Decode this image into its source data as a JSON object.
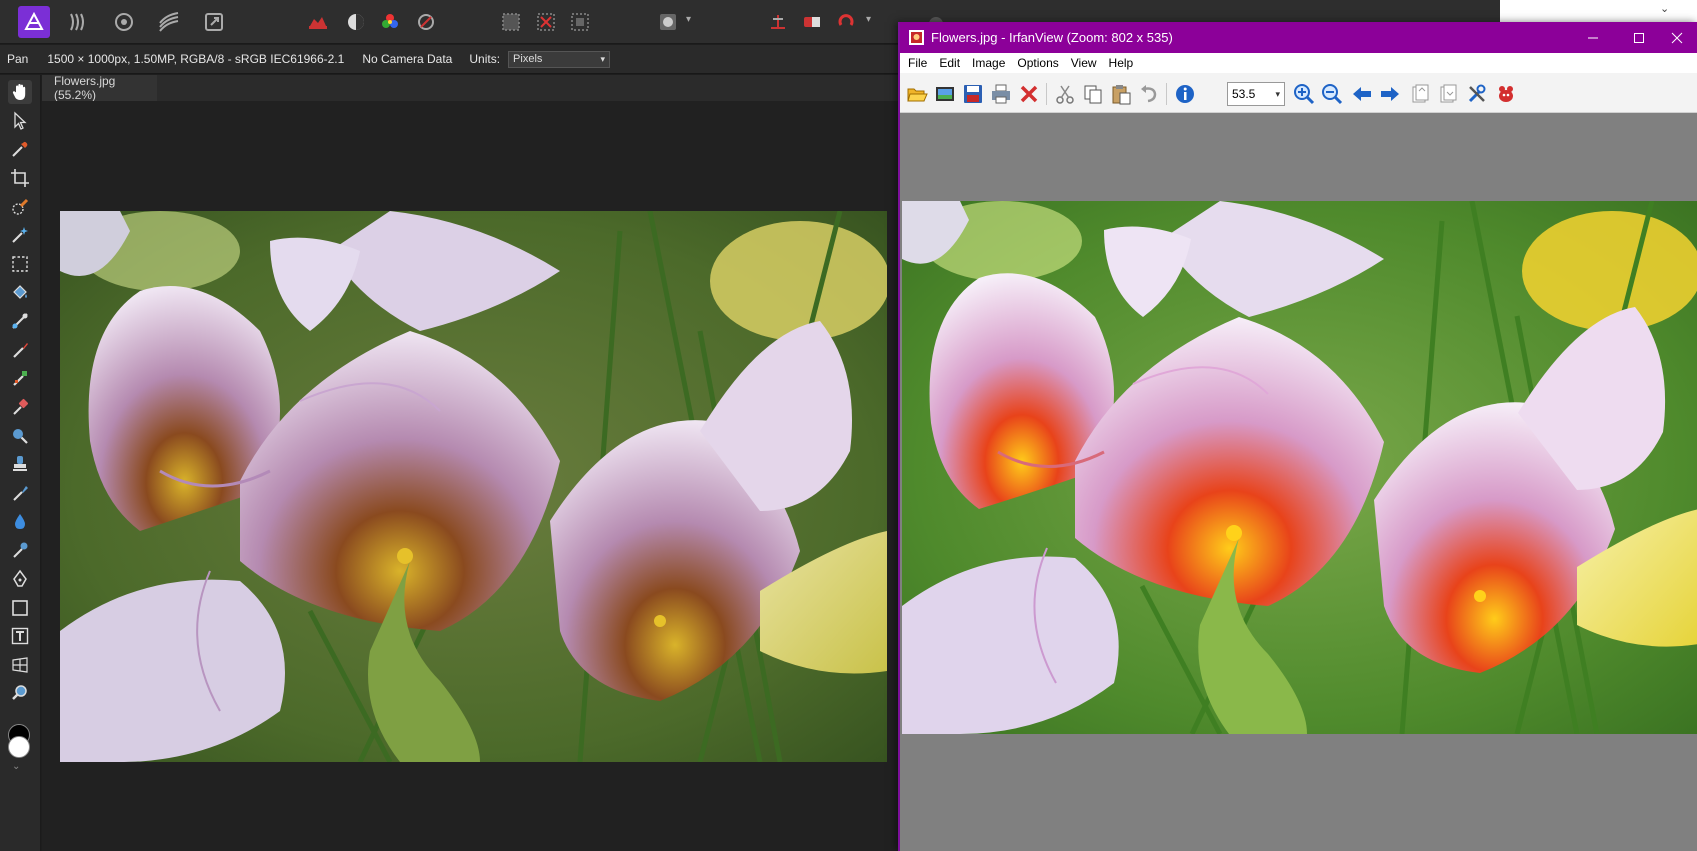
{
  "affinity": {
    "context": {
      "tool": "Pan",
      "doc_info": "1500 × 1000px, 1.50MP, RGBA/8 - sRGB IEC61966-2.1",
      "camera": "No Camera Data",
      "units_label": "Units:",
      "units_value": "Pixels"
    },
    "doc_tab": "Flowers.jpg (55.2%)",
    "accent": "#8a2be2",
    "persona_icons": [
      "photo-persona-icon",
      "liquify-persona-icon",
      "develop-persona-icon",
      "tone-mapping-persona-icon",
      "export-persona-icon"
    ],
    "tools": [
      "pan-tool-icon",
      "move-tool-icon",
      "color-picker-icon",
      "crop-tool-icon",
      "selection-brush-icon",
      "flood-select-icon",
      "marquee-tool-icon",
      "flood-fill-icon",
      "gradient-tool-icon",
      "paint-brush-icon",
      "pixel-tool-icon",
      "erase-brush-icon",
      "dodge-tool-icon",
      "clone-tool-icon",
      "blemish-tool-icon",
      "blur-brush-icon",
      "red-eye-tool-icon",
      "pen-tool-icon",
      "rectangle-tool-icon",
      "text-tool-icon",
      "mesh-warp-icon",
      "zoom-tool-icon"
    ]
  },
  "irfanview": {
    "title": "Flowers.jpg - IrfanView (Zoom: 802 x 535)",
    "title_bar_color": "#8c0099",
    "menu": [
      "File",
      "Edit",
      "Image",
      "Options",
      "View",
      "Help"
    ],
    "zoom_value": "53.5",
    "toolbar_icons": [
      "open-icon",
      "slideshow-icon",
      "save-icon",
      "print-icon",
      "delete-icon",
      "cut-icon",
      "copy-icon",
      "paste-icon",
      "undo-icon",
      "info-icon",
      "zoom-in-icon",
      "zoom-out-icon",
      "previous-icon",
      "next-icon",
      "first-page-icon",
      "last-page-icon",
      "settings-icon",
      "irfanview-logo-icon"
    ]
  }
}
